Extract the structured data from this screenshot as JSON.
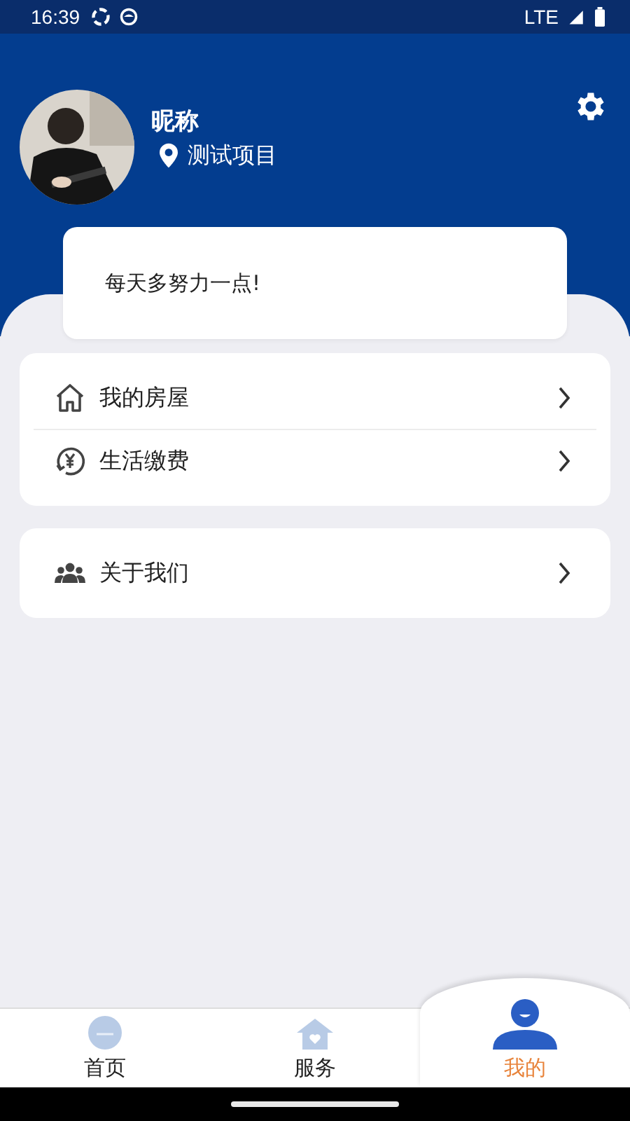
{
  "status_bar": {
    "time": "16:39",
    "network": "LTE"
  },
  "profile": {
    "nickname": "昵称",
    "location": "测试项目"
  },
  "motto": "每天多努力一点!",
  "menu_groups": [
    {
      "items": [
        {
          "kind": "house",
          "label": "我的房屋"
        },
        {
          "kind": "payment",
          "label": "生活缴费"
        }
      ]
    },
    {
      "items": [
        {
          "kind": "people",
          "label": "关于我们"
        }
      ]
    }
  ],
  "tabs": [
    {
      "kind": "home",
      "label": "首页",
      "selected": false
    },
    {
      "kind": "service",
      "label": "服务",
      "selected": false
    },
    {
      "kind": "mine",
      "label": "我的",
      "selected": true
    }
  ]
}
